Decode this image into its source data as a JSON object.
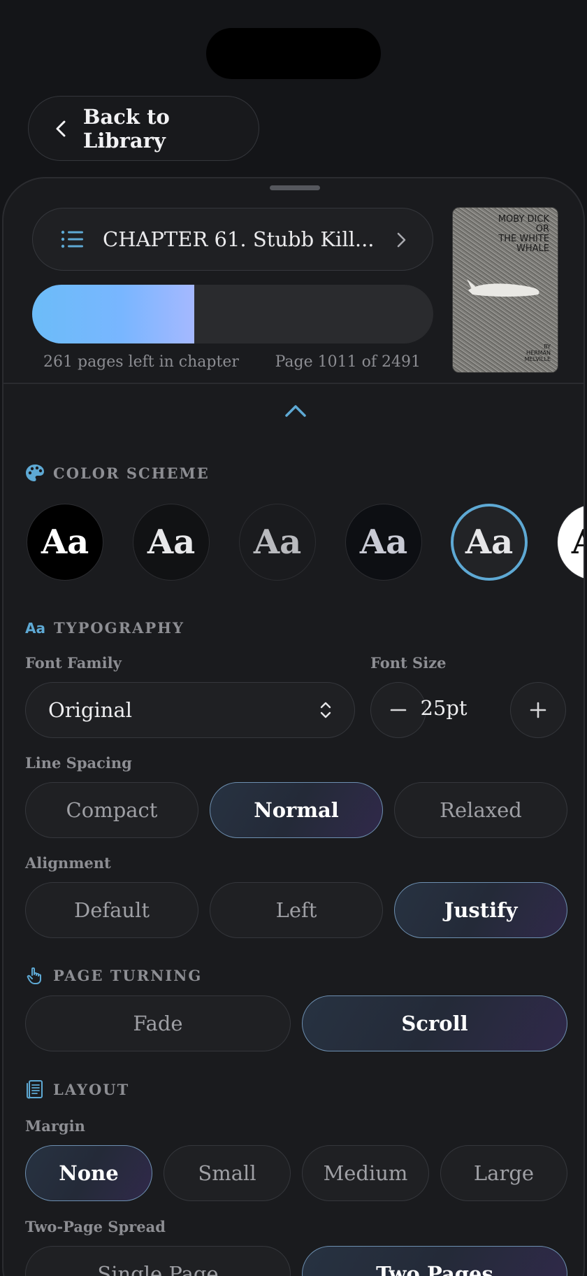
{
  "nav": {
    "back_label": "Back to Library"
  },
  "chapter": {
    "title": "CHAPTER 61. Stubb Kill...",
    "progress_fraction": 0.405,
    "pages_left_label": "261 pages left in chapter",
    "page_label": "Page 1011 of 2491"
  },
  "cover": {
    "title_lines": [
      "MOBY DICK",
      "OR",
      "THE WHITE",
      "WHALE"
    ],
    "author_lines": [
      "BY",
      "HERMAN",
      "MELVILLE"
    ]
  },
  "color_scheme": {
    "heading": "COLOR SCHEME",
    "sample": "Aa",
    "options": [
      {
        "bg": "#000000",
        "fg": "#ffffff"
      },
      {
        "bg": "#111214",
        "fg": "#e8e8ea"
      },
      {
        "bg": "#1a1b1e",
        "fg": "#b9babe"
      },
      {
        "bg": "#0d0f13",
        "fg": "#c8cad4"
      },
      {
        "bg": "#222326",
        "fg": "#e6e6e8",
        "selected": true
      },
      {
        "bg": "#ffffff",
        "fg": "#111111"
      }
    ]
  },
  "typography": {
    "heading": "TYPOGRAPHY",
    "icon_text": "Aa",
    "font_family_label": "Font Family",
    "font_family_value": "Original",
    "font_size_label": "Font Size",
    "font_size_value": "25pt",
    "line_spacing_label": "Line Spacing",
    "line_spacing_options": [
      "Compact",
      "Normal",
      "Relaxed"
    ],
    "line_spacing_selected": "Normal",
    "alignment_label": "Alignment",
    "alignment_options": [
      "Default",
      "Left",
      "Justify"
    ],
    "alignment_selected": "Justify"
  },
  "page_turning": {
    "heading": "PAGE TURNING",
    "options": [
      "Fade",
      "Scroll"
    ],
    "selected": "Scroll"
  },
  "layout": {
    "heading": "LAYOUT",
    "margin_label": "Margin",
    "margin_options": [
      "None",
      "Small",
      "Medium",
      "Large"
    ],
    "margin_selected": "None",
    "spread_label": "Two-Page Spread",
    "spread_options": [
      "Single Page",
      "Two Pages"
    ],
    "spread_selected": "Two Pages"
  },
  "colors": {
    "accent": "#5ea9d4",
    "progress_start": "#6cbcf8",
    "progress_end": "#a5b8ff"
  }
}
